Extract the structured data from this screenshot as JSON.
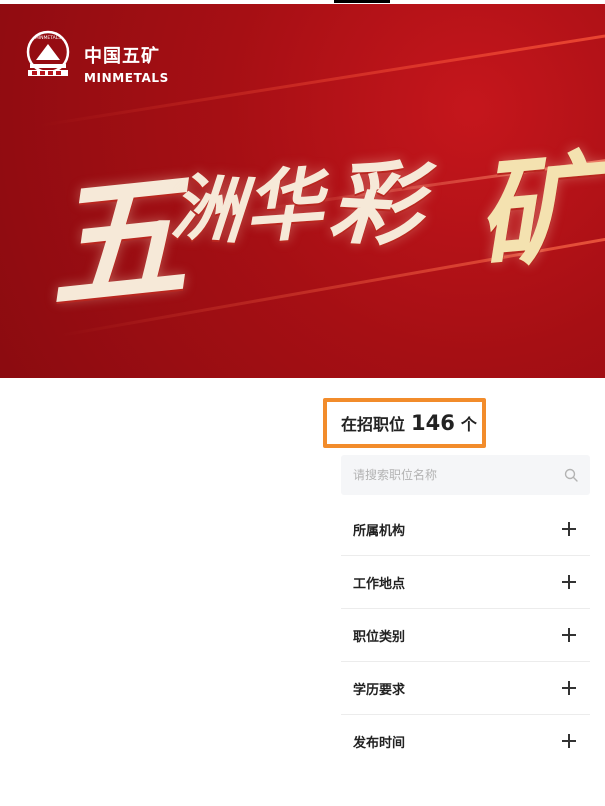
{
  "brand": {
    "name_cn": "中国五矿",
    "name_en": "MINMETALS",
    "emblem_text": "MINMETALS"
  },
  "banner": {
    "calligraphy": [
      "五",
      "洲",
      "华",
      "彩",
      "矿"
    ]
  },
  "jobs": {
    "label": "在招职位",
    "count": "146",
    "unit": "个"
  },
  "search": {
    "placeholder": "请搜索职位名称",
    "value": ""
  },
  "filters": [
    {
      "label": "所属机构",
      "icon": "plus-icon"
    },
    {
      "label": "工作地点",
      "icon": "plus-icon"
    },
    {
      "label": "职位类别",
      "icon": "plus-icon"
    },
    {
      "label": "学历要求",
      "icon": "plus-icon"
    },
    {
      "label": "发布时间",
      "icon": "plus-icon"
    }
  ],
  "colors": {
    "banner_red": "#a60f14",
    "highlight_orange": "#f28c2b",
    "text_dark": "#222222"
  }
}
